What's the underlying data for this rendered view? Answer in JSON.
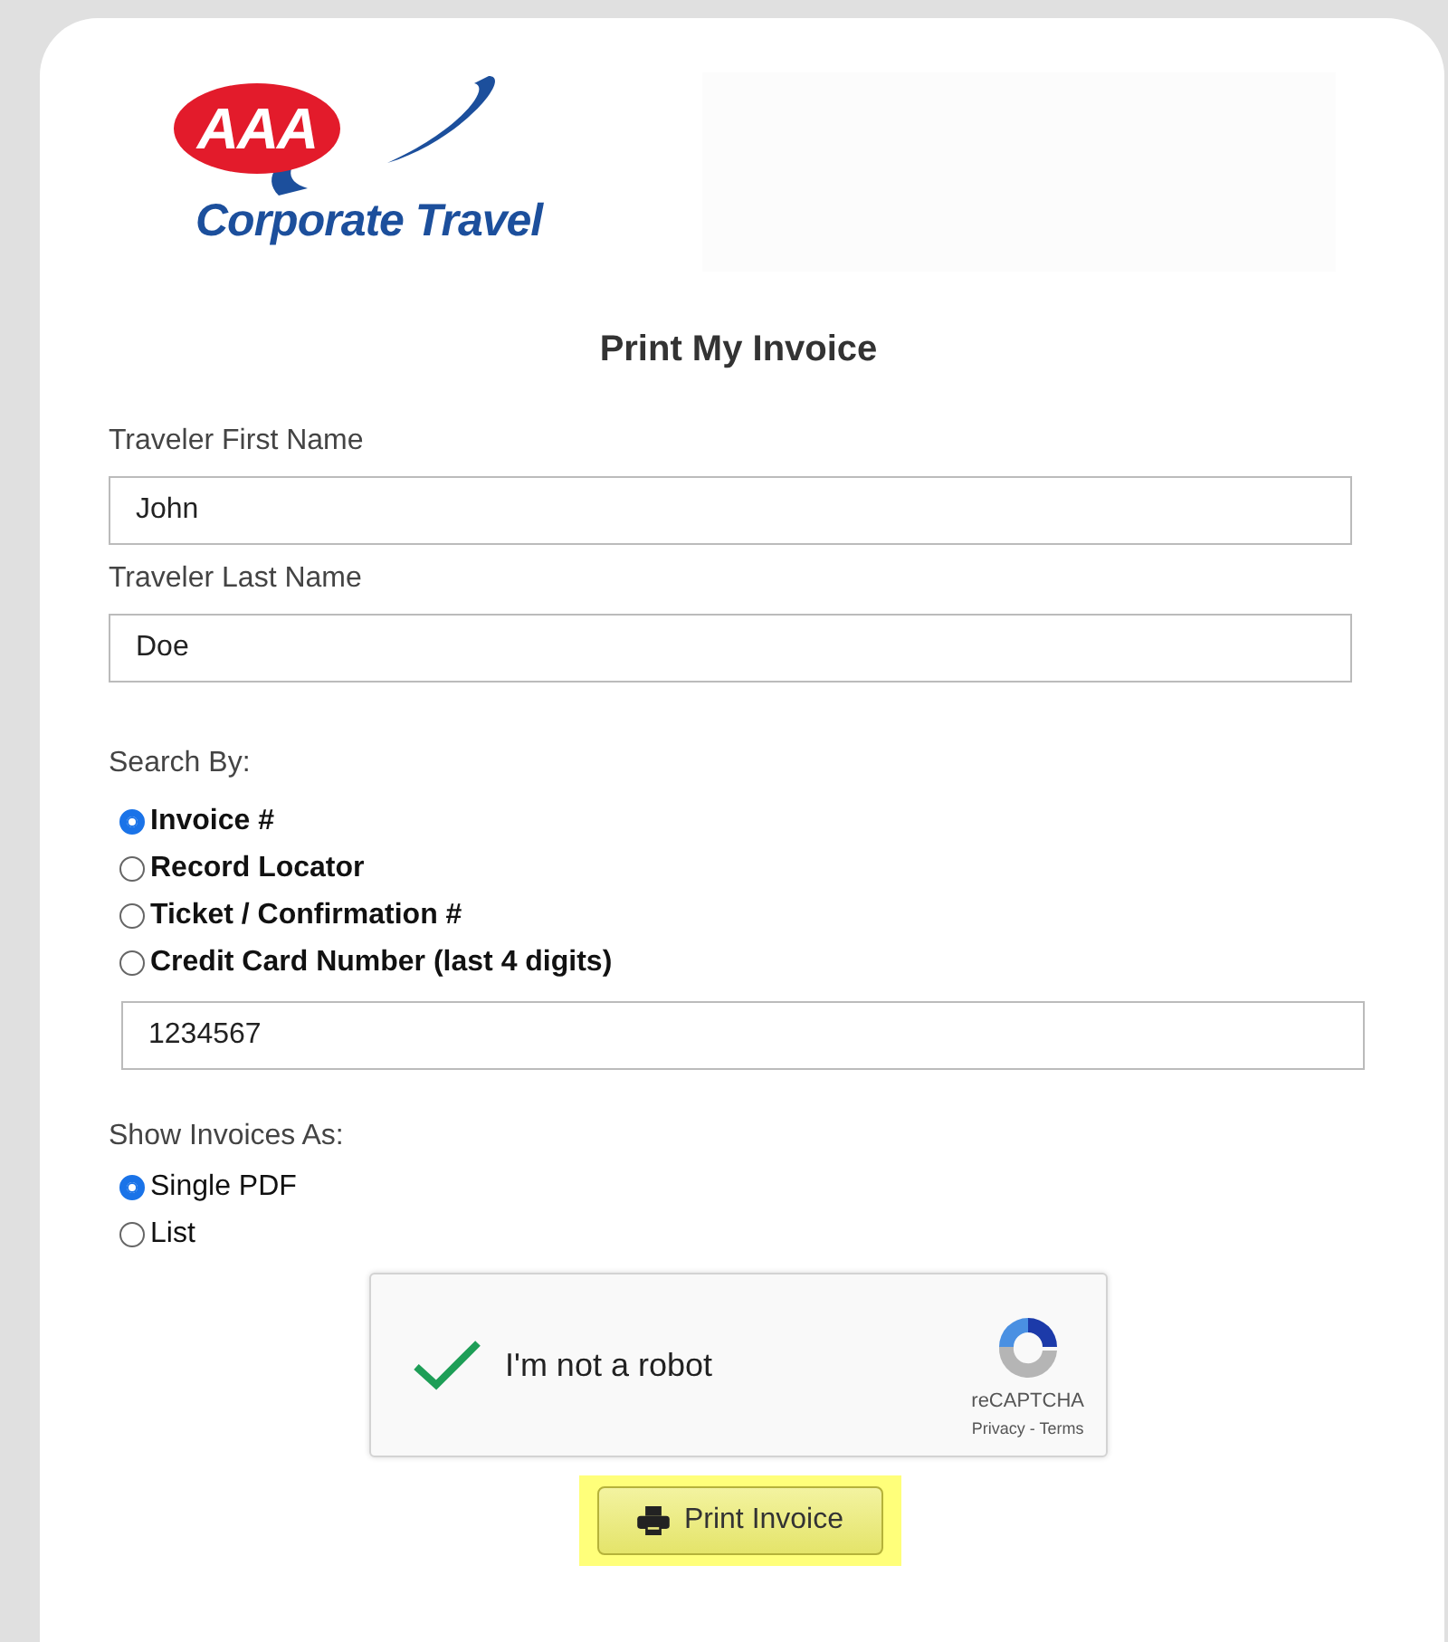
{
  "logo": {
    "mark": "AAA",
    "name": "Corporate Travel"
  },
  "title": "Print My Invoice",
  "fields": [
    {
      "label": "Traveler First Name",
      "value": "John"
    },
    {
      "label": "Traveler Last Name",
      "value": "Doe"
    }
  ],
  "search_by": {
    "label": "Search By:",
    "options": [
      {
        "label": "Invoice #",
        "selected": true
      },
      {
        "label": "Record Locator",
        "selected": false
      },
      {
        "label": "Ticket / Confirmation #",
        "selected": false
      },
      {
        "label": "Credit Card Number (last 4 digits)",
        "selected": false
      }
    ],
    "value": "1234567"
  },
  "show_as": {
    "label": "Show Invoices As:",
    "options": [
      {
        "label": "Single PDF",
        "selected": true
      },
      {
        "label": "List",
        "selected": false
      }
    ]
  },
  "captcha": {
    "label": "I'm not a robot",
    "checked": true,
    "brand": "reCAPTCHA",
    "links": "Privacy - Terms"
  },
  "button": {
    "label": "Print Invoice",
    "highlighted": true
  }
}
